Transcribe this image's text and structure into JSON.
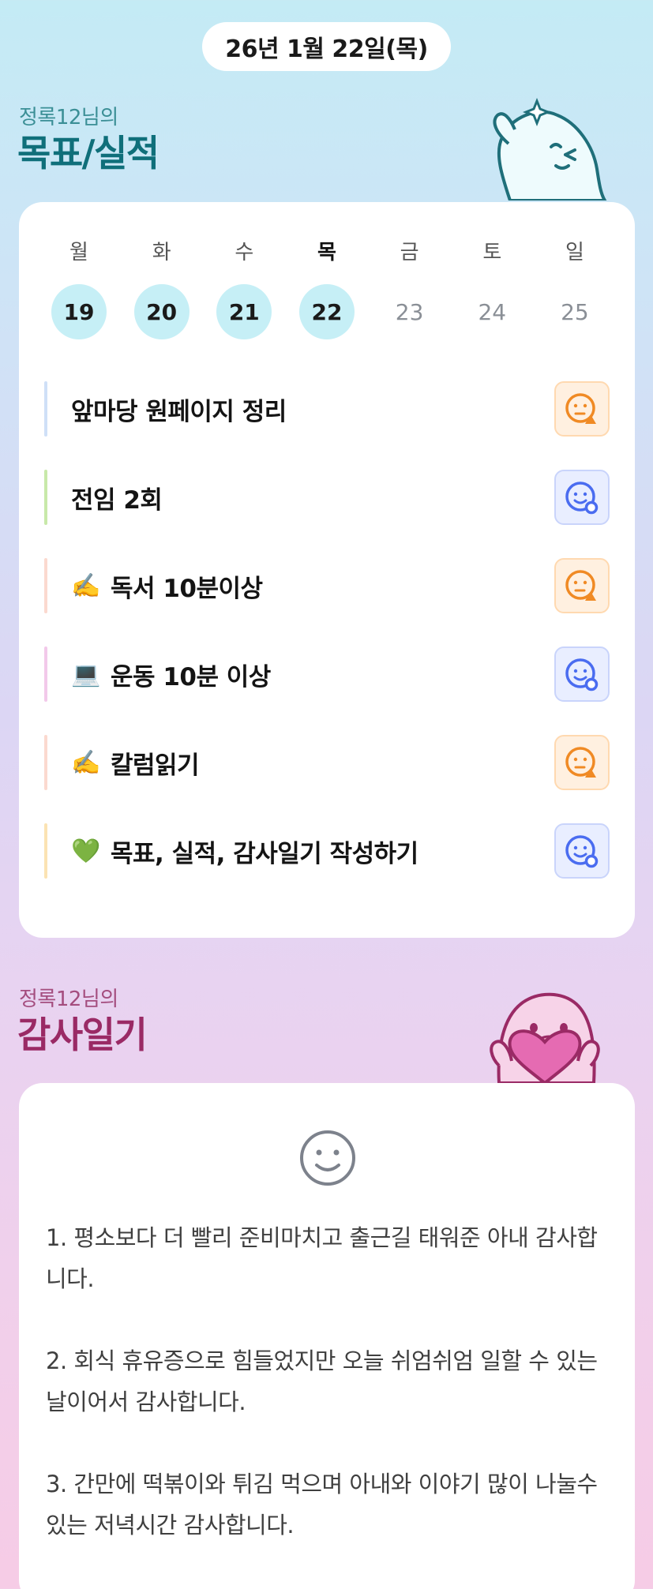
{
  "header": {
    "date": "26년 1월 22일(목)"
  },
  "goals": {
    "subtitle": "정록12님의",
    "title": "목표/실적",
    "week": [
      {
        "name": "월",
        "num": "19",
        "state": "done"
      },
      {
        "name": "화",
        "num": "20",
        "state": "done"
      },
      {
        "name": "수",
        "num": "21",
        "state": "done"
      },
      {
        "name": "목",
        "num": "22",
        "state": "today"
      },
      {
        "name": "금",
        "num": "23",
        "state": "future"
      },
      {
        "name": "토",
        "num": "24",
        "state": "future"
      },
      {
        "name": "일",
        "num": "25",
        "state": "future"
      }
    ],
    "tasks": [
      {
        "emoji": "",
        "label": "앞마당 원페이지 정리",
        "bar_color": "#cfe0f7",
        "status": "orange"
      },
      {
        "emoji": "",
        "label": "전임 2회",
        "bar_color": "#c8e9a9",
        "status": "blue"
      },
      {
        "emoji": "✍️",
        "label": "독서 10분이상",
        "bar_color": "#fbd9cf",
        "status": "orange"
      },
      {
        "emoji": "💻",
        "label": "운동 10분 이상",
        "bar_color": "#f2c9ea",
        "status": "blue"
      },
      {
        "emoji": "✍️",
        "label": "칼럼읽기",
        "bar_color": "#fbd9cf",
        "status": "orange"
      },
      {
        "emoji": "💚",
        "label": "목표, 실적, 감사일기 작성하기",
        "bar_color": "#fbe3b3",
        "status": "blue"
      }
    ]
  },
  "thanks": {
    "subtitle": "정록12님의",
    "title": "감사일기",
    "items": [
      "1. 평소보다 더 빨리 준비마치고 출근길 태워준 아내 감사합니다.",
      "2. 회식 휴유증으로 힘들었지만 오늘 쉬엄쉬엄 일할 수 있는 날이어서 감사합니다.",
      "3. 간만에 떡볶이와 튀김 먹으며 아내와 이야기 많이 나눌수 있는 저녁시간 감사합니다."
    ]
  },
  "colors": {
    "goals_title": "#0f6f7a",
    "thanks_title": "#9a2a65",
    "done_day": "#c6eff6",
    "status_orange": "#f08a24",
    "status_blue": "#4a6cf0"
  }
}
